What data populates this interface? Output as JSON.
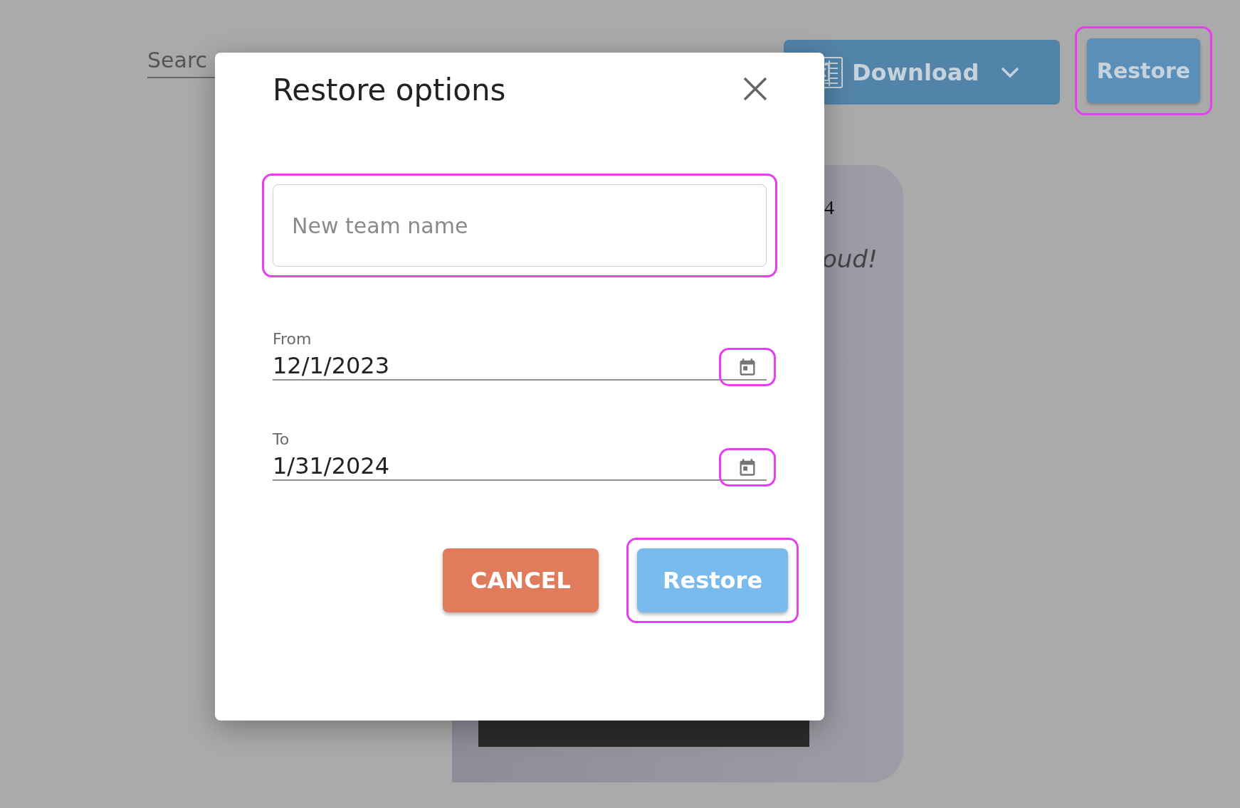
{
  "page": {
    "search": {
      "placeholder": "Searc"
    },
    "download_button": {
      "label": "Download"
    },
    "restore_button": {
      "label": "Restore",
      "highlighted": true
    },
    "card": {
      "text_1": "4",
      "text_2": "oud!"
    }
  },
  "dialog": {
    "title": "Restore options",
    "team_name": {
      "placeholder": "New team name",
      "highlighted": true
    },
    "date_fields": [
      {
        "label": "From",
        "value": "12/1/2023",
        "icon_highlighted": true
      },
      {
        "label": "To",
        "value": "1/31/2024",
        "icon_highlighted": true
      }
    ],
    "buttons": [
      {
        "kind": "cancel",
        "label": "CANCEL",
        "highlighted": false
      },
      {
        "kind": "confirm",
        "label": "Restore",
        "highlighted": true
      }
    ]
  }
}
